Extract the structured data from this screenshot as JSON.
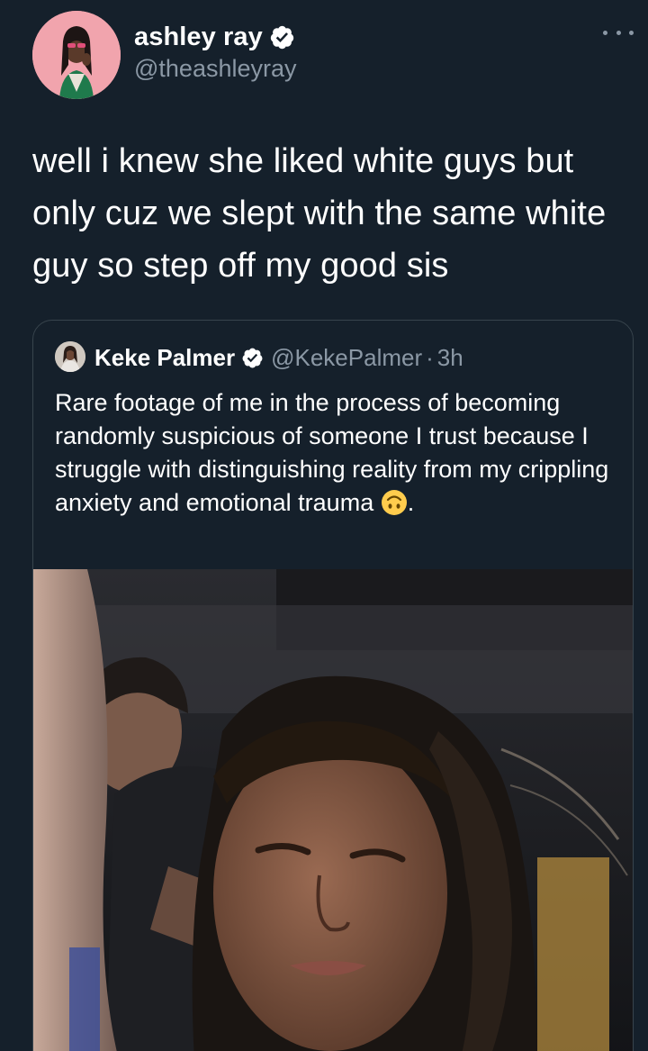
{
  "author": {
    "display_name": "ashley ray",
    "handle": "@theashleyray",
    "verified": true,
    "avatar_icon": "avatar-photo"
  },
  "tweet": {
    "text": "well i knew she liked white guys but only cuz we slept with the same white guy so step off my good sis"
  },
  "quoted_tweet": {
    "display_name": "Keke Palmer",
    "handle": "@KekePalmer",
    "separator": "·",
    "time": "3h",
    "text": "Rare footage of me in the process of becoming randomly suspicious of someone I trust because I struggle with distinguishing reality from my crippling anxiety and emotional trauma",
    "emoji": "upside-down-face-emoji",
    "text_end": ".",
    "media": "photo-selfie"
  },
  "colors": {
    "background": "#15202b",
    "text": "#ffffff",
    "secondary_text": "#8b98a5",
    "border": "#38444d",
    "verified_badge": "#ffffff"
  }
}
